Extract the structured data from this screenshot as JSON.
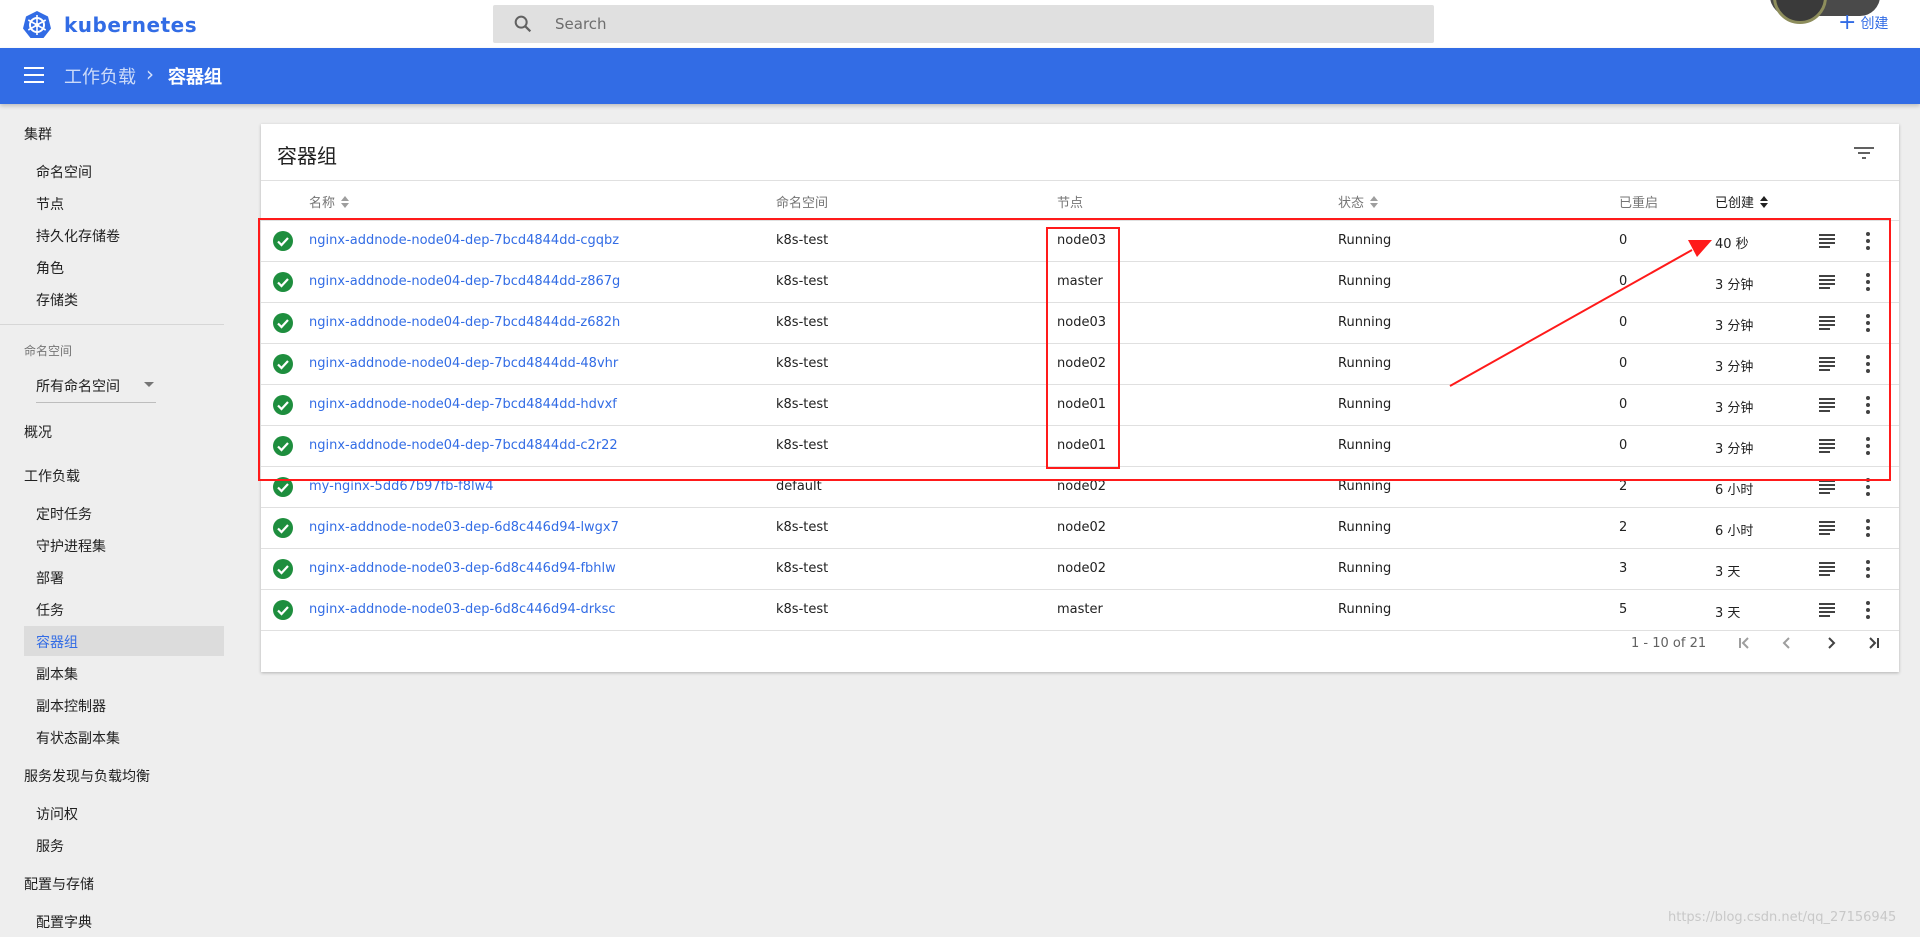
{
  "app": {
    "logo_text": "kubernetes"
  },
  "search": {
    "placeholder": "Search"
  },
  "header": {
    "create_label": "创建"
  },
  "breadcrumb": {
    "parent": "工作负载",
    "current": "容器组"
  },
  "sidebar": {
    "cluster_title": "集群",
    "cluster_items": [
      "命名空间",
      "节点",
      "持久化存储卷",
      "角色",
      "存储类"
    ],
    "namespace_label": "命名空间",
    "namespace_value": "所有命名空间",
    "overview": "概况",
    "workloads_title": "工作负载",
    "workload_items": [
      "定时任务",
      "守护进程集",
      "部署",
      "任务",
      "容器组",
      "副本集",
      "副本控制器",
      "有状态副本集"
    ],
    "active_item": "容器组",
    "discovery_title": "服务发现与负载均衡",
    "discovery_items": [
      "访问权",
      "服务"
    ],
    "config_title": "配置与存储",
    "config_items": [
      "配置字典"
    ]
  },
  "card": {
    "title": "容器组",
    "columns": {
      "name": "名称",
      "namespace": "命名空间",
      "node": "节点",
      "status": "状态",
      "restarts": "已重启",
      "created": "已创建"
    },
    "rows": [
      {
        "name": "nginx-addnode-node04-dep-7bcd4844dd-cgqbz",
        "namespace": "k8s-test",
        "node": "node03",
        "status": "Running",
        "restarts": "0",
        "age": "40 秒"
      },
      {
        "name": "nginx-addnode-node04-dep-7bcd4844dd-z867g",
        "namespace": "k8s-test",
        "node": "master",
        "status": "Running",
        "restarts": "0",
        "age": "3 分钟"
      },
      {
        "name": "nginx-addnode-node04-dep-7bcd4844dd-z682h",
        "namespace": "k8s-test",
        "node": "node03",
        "status": "Running",
        "restarts": "0",
        "age": "3 分钟"
      },
      {
        "name": "nginx-addnode-node04-dep-7bcd4844dd-48vhr",
        "namespace": "k8s-test",
        "node": "node02",
        "status": "Running",
        "restarts": "0",
        "age": "3 分钟"
      },
      {
        "name": "nginx-addnode-node04-dep-7bcd4844dd-hdvxf",
        "namespace": "k8s-test",
        "node": "node01",
        "status": "Running",
        "restarts": "0",
        "age": "3 分钟"
      },
      {
        "name": "nginx-addnode-node04-dep-7bcd4844dd-c2r22",
        "namespace": "k8s-test",
        "node": "node01",
        "status": "Running",
        "restarts": "0",
        "age": "3 分钟"
      },
      {
        "name": "my-nginx-5dd67b97fb-f8lw4",
        "namespace": "default",
        "node": "node02",
        "status": "Running",
        "restarts": "2",
        "age": "6 小时"
      },
      {
        "name": "nginx-addnode-node03-dep-6d8c446d94-lwgx7",
        "namespace": "k8s-test",
        "node": "node02",
        "status": "Running",
        "restarts": "2",
        "age": "6 小时"
      },
      {
        "name": "nginx-addnode-node03-dep-6d8c446d94-fbhlw",
        "namespace": "k8s-test",
        "node": "node02",
        "status": "Running",
        "restarts": "3",
        "age": "3 天"
      },
      {
        "name": "nginx-addnode-node03-dep-6d8c446d94-drksc",
        "namespace": "k8s-test",
        "node": "master",
        "status": "Running",
        "restarts": "5",
        "age": "3 天"
      }
    ],
    "pagination": "1 - 10 of 21"
  },
  "colors": {
    "brand": "#326ce5",
    "status_ok": "#1e8e3e",
    "annotation": "#ff1a1a"
  },
  "watermark": "https://blog.csdn.net/qq_27156945"
}
